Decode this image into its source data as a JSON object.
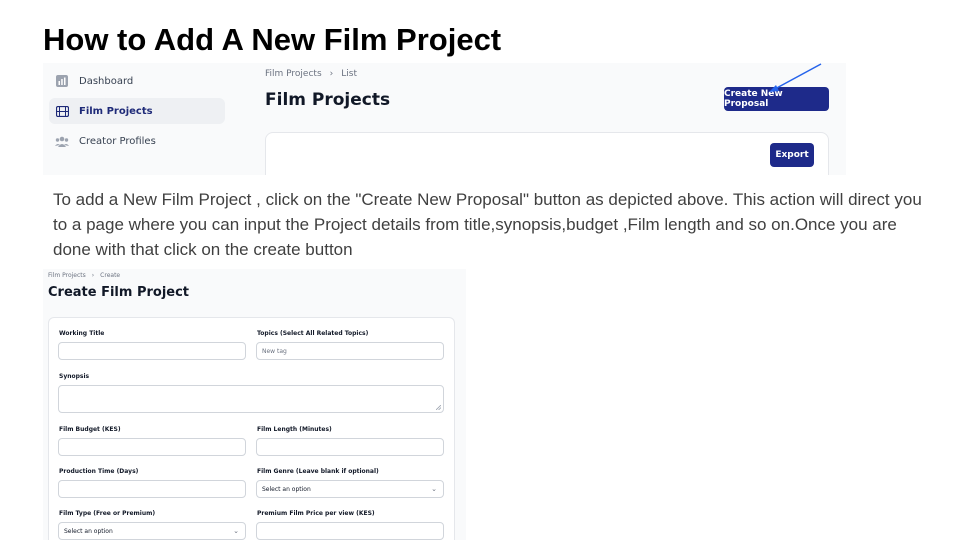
{
  "slide": {
    "title": "How to Add A New Film Project",
    "description": "To add a New Film Project , click on the \"Create New Proposal\" button as depicted above. This action will direct you to a page where you can input the Project details from title,synopsis,budget ,Film length and so on.Once you are done with that click on the create button"
  },
  "list_screen": {
    "sidebar": {
      "items": [
        {
          "label": "Dashboard",
          "icon": "chart-icon",
          "active": false
        },
        {
          "label": "Film Projects",
          "icon": "film-icon",
          "active": true
        },
        {
          "label": "Creator Profiles",
          "icon": "users-icon",
          "active": false
        }
      ]
    },
    "breadcrumb": [
      "Film Projects",
      "List"
    ],
    "heading": "Film Projects",
    "create_button": "Create New Proposal",
    "export_button": "Export",
    "accent_color": "#1e2a8a"
  },
  "create_screen": {
    "breadcrumb": [
      "Film Projects",
      "Create"
    ],
    "heading": "Create Film Project",
    "fields": {
      "working_title": {
        "label": "Working Title",
        "value": ""
      },
      "topics": {
        "label": "Topics (Select All Related Topics)",
        "placeholder": "New tag"
      },
      "synopsis": {
        "label": "Synopsis",
        "value": ""
      },
      "budget": {
        "label": "Film Budget (KES)",
        "value": ""
      },
      "length": {
        "label": "Film Length (Minutes)",
        "value": ""
      },
      "production_time": {
        "label": "Production Time (Days)",
        "value": ""
      },
      "genre": {
        "label": "Film Genre (Leave blank if optional)",
        "selected": "Select an option"
      },
      "film_type": {
        "label": "Film Type (Free or Premium)",
        "selected": "Select an option"
      },
      "premium_price": {
        "label": "Premium Film Price per view (KES)",
        "value": ""
      }
    }
  }
}
